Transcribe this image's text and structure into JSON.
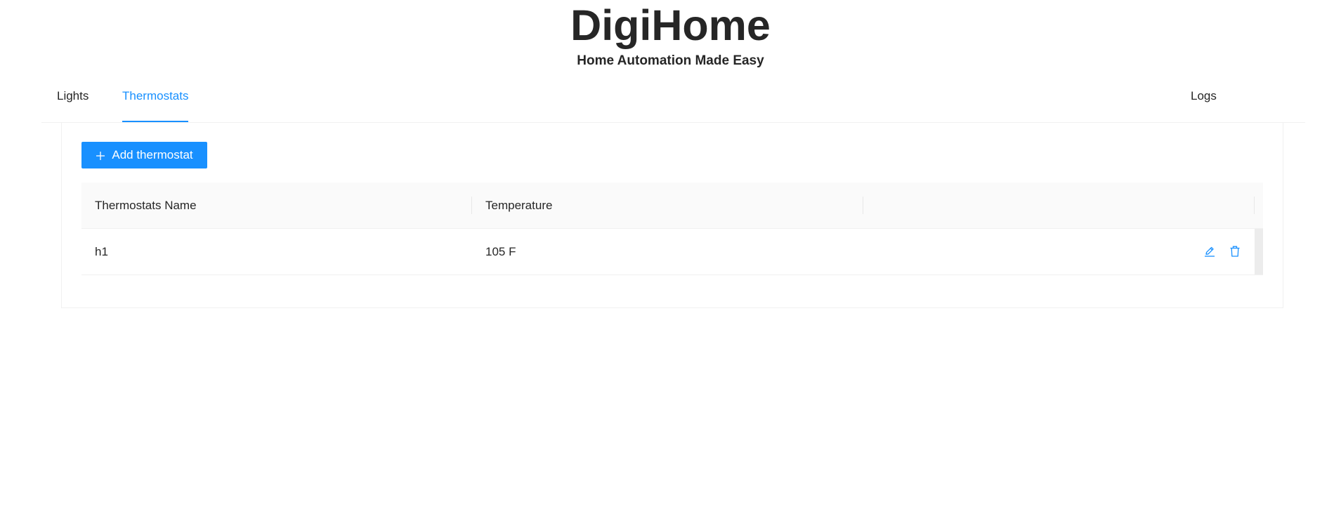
{
  "app": {
    "title": "DigiHome",
    "subtitle": "Home Automation Made Easy"
  },
  "tabs": [
    {
      "label": "Lights",
      "active": false
    },
    {
      "label": "Thermostats",
      "active": true
    },
    {
      "label": "Logs",
      "active": false
    }
  ],
  "toolbar": {
    "add_label": "Add thermostat",
    "add_icon": "plus-icon"
  },
  "table": {
    "columns": [
      "Thermostats Name",
      "Temperature",
      ""
    ],
    "rows": [
      {
        "name": "h1",
        "temperature": "105 F",
        "actions": [
          "edit-icon",
          "delete-icon"
        ]
      }
    ]
  },
  "colors": {
    "accent": "#1890ff",
    "text": "#262626",
    "header_bg": "#fafafa",
    "border": "#f0f0f0"
  }
}
